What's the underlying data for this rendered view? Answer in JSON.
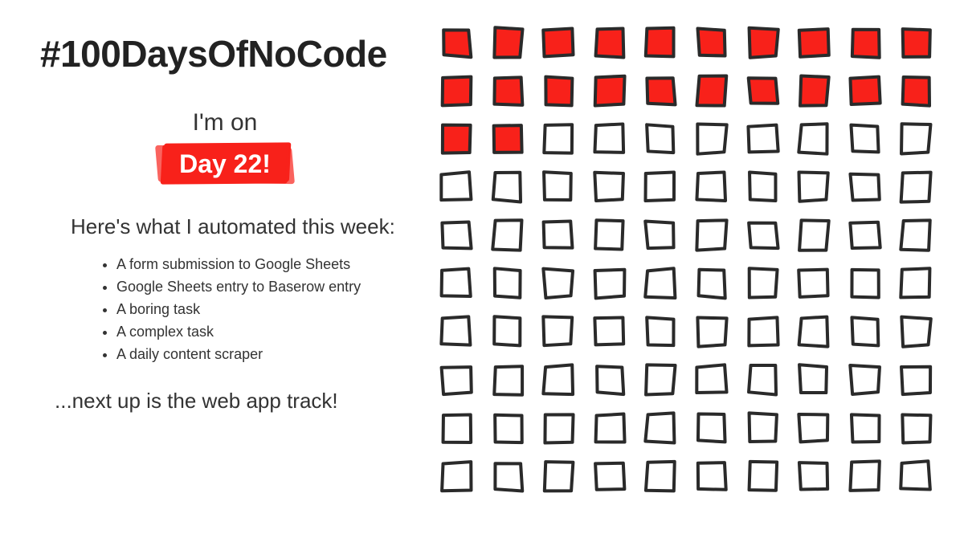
{
  "title": "#100DaysOfNoCode",
  "im_on_label": "I'm on",
  "day_badge": "Day 22!",
  "intro": "Here's what I automated this week:",
  "tasks": [
    "A form submission to Google Sheets",
    "Google Sheets entry to Baserow entry",
    "A boring task",
    "A complex task",
    "A daily content scraper"
  ],
  "next_up": "...next up is the web app track!",
  "progress": {
    "total_days": 100,
    "grid_columns": 10,
    "grid_rows": 10,
    "completed_days": 22
  },
  "colors": {
    "accent": "#f8211a",
    "text": "#2a2a2a",
    "background": "#ffffff"
  }
}
